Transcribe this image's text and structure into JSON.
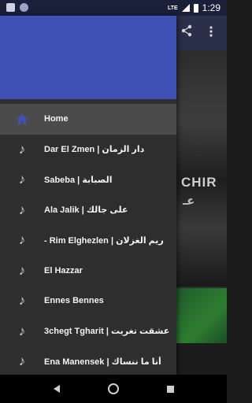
{
  "status_bar": {
    "time": "1:29",
    "network": "LTE",
    "icons": [
      "notification-icon",
      "notification-icon",
      "signal-icon",
      "battery-icon"
    ]
  },
  "app_bar": {
    "actions": [
      "share-icon",
      "more-vert-icon"
    ]
  },
  "background": {
    "caption_line1": "CHIR",
    "caption_line2": "عـ"
  },
  "drawer": {
    "header_color": "#3f51b5",
    "items": [
      {
        "label": "Home",
        "icon": "home-icon",
        "active": true
      },
      {
        "label": "Dar El Zmen | دار الزمان",
        "icon": "music-note-icon",
        "active": false
      },
      {
        "label": "Sabeba | الصبابة",
        "icon": "music-note-icon",
        "active": false
      },
      {
        "label": "Ala Jalik | على جالك",
        "icon": "music-note-icon",
        "active": false
      },
      {
        "label": "- Rim Elghezlen | ريم الغزلان",
        "icon": "music-note-icon",
        "active": false
      },
      {
        "label": "El Hazzar",
        "icon": "music-note-icon",
        "active": false
      },
      {
        "label": "Ennes Bennes",
        "icon": "music-note-icon",
        "active": false
      },
      {
        "label": "3chegt Tgharit | عشقت تغريت",
        "icon": "music-note-icon",
        "active": false
      },
      {
        "label": "Ena Manensek | أنا ما ننساك",
        "icon": "music-note-icon",
        "active": false
      }
    ]
  },
  "nav_bar": {
    "buttons": [
      "back-icon",
      "home-circle-icon",
      "recents-icon"
    ]
  }
}
